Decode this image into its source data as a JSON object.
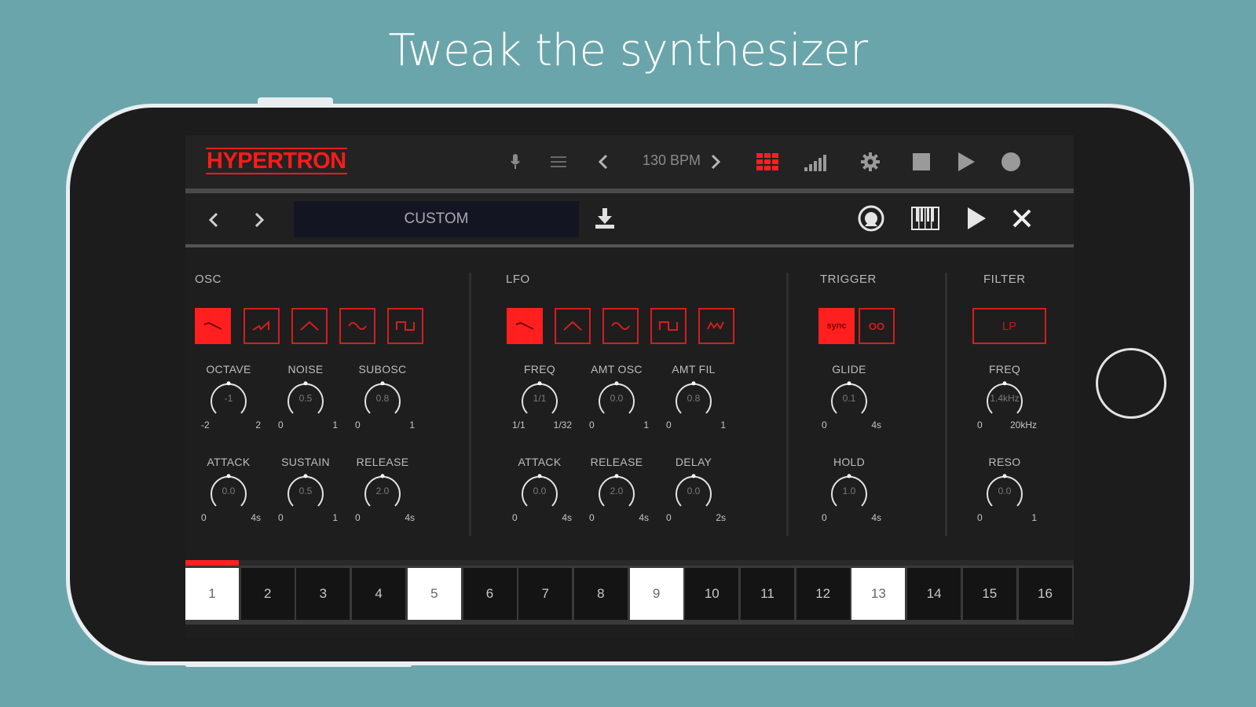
{
  "headline": "Tweak the synthesizer",
  "app": {
    "logo": "HYPERTRON",
    "bpm": "130 BPM"
  },
  "preset": {
    "name": "CUSTOM"
  },
  "sections": {
    "osc": "OSC",
    "lfo": "LFO",
    "trigger": "TRIGGER",
    "filter": "FILTER"
  },
  "trigger_buttons": {
    "sync": "sync",
    "loop": "OO"
  },
  "filter_type": "LP",
  "knobs": {
    "octave": {
      "label": "OCTAVE",
      "value": "-1",
      "min": "-2",
      "max": "2"
    },
    "noise": {
      "label": "NOISE",
      "value": "0.5",
      "min": "0",
      "max": "1"
    },
    "subosc": {
      "label": "SUBOSC",
      "value": "0.8",
      "min": "0",
      "max": "1"
    },
    "osc_attack": {
      "label": "ATTACK",
      "value": "0.0",
      "min": "0",
      "max": "4s"
    },
    "osc_sustain": {
      "label": "SUSTAIN",
      "value": "0.5",
      "min": "0",
      "max": "1"
    },
    "osc_release": {
      "label": "RELEASE",
      "value": "2.0",
      "min": "0",
      "max": "4s"
    },
    "lfo_freq": {
      "label": "FREQ",
      "value": "1/1",
      "min": "1/1",
      "max": "1/32"
    },
    "amt_osc": {
      "label": "AMT OSC",
      "value": "0.0",
      "min": "0",
      "max": "1"
    },
    "amt_fil": {
      "label": "AMT FIL",
      "value": "0.8",
      "min": "0",
      "max": "1"
    },
    "lfo_attack": {
      "label": "ATTACK",
      "value": "0.0",
      "min": "0",
      "max": "4s"
    },
    "lfo_release": {
      "label": "RELEASE",
      "value": "2.0",
      "min": "0",
      "max": "4s"
    },
    "lfo_delay": {
      "label": "DELAY",
      "value": "0.0",
      "min": "0",
      "max": "2s"
    },
    "glide": {
      "label": "GLIDE",
      "value": "0.1",
      "min": "0",
      "max": "4s"
    },
    "hold": {
      "label": "HOLD",
      "value": "1.0",
      "min": "0",
      "max": "4s"
    },
    "filter_freq": {
      "label": "FREQ",
      "value": "1.4kHz",
      "min": "0",
      "max": "20kHz"
    },
    "reso": {
      "label": "RESO",
      "value": "0.0",
      "min": "0",
      "max": "1"
    }
  },
  "steps": [
    "1",
    "2",
    "3",
    "4",
    "5",
    "6",
    "7",
    "8",
    "9",
    "10",
    "11",
    "12",
    "13",
    "14",
    "15",
    "16"
  ],
  "active_steps": [
    1,
    5,
    9,
    13
  ],
  "colors": {
    "accent": "#ff1f1f",
    "background": "#6aa5ab",
    "panel": "#1e1e1e"
  }
}
